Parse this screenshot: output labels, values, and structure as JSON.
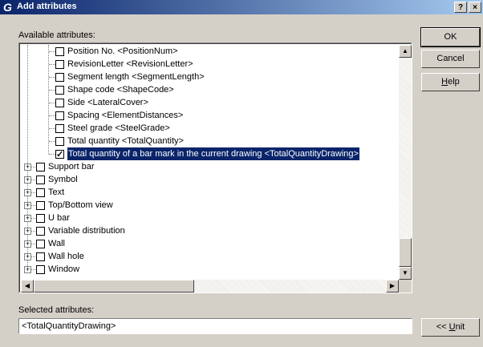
{
  "window": {
    "title": "Add attributes",
    "help_glyph": "?",
    "close_glyph": "×"
  },
  "available_label": "Available attributes:",
  "children": [
    {
      "label": "Position No. <PositionNum>",
      "checked": false
    },
    {
      "label": "RevisionLetter <RevisionLetter>",
      "checked": false
    },
    {
      "label": "Segment length <SegmentLength>",
      "checked": false
    },
    {
      "label": "Shape code <ShapeCode>",
      "checked": false
    },
    {
      "label": "Side <LateralCover>",
      "checked": false
    },
    {
      "label": "Spacing <ElementDistances>",
      "checked": false
    },
    {
      "label": "Steel grade <SteelGrade>",
      "checked": false
    },
    {
      "label": "Total quantity <TotalQuantity>",
      "checked": false
    },
    {
      "label": "Total quantity of a bar mark in the current drawing <TotalQuantityDrawing>",
      "checked": true,
      "selected": true
    }
  ],
  "groups": [
    {
      "label": "Support bar"
    },
    {
      "label": "Symbol"
    },
    {
      "label": "Text"
    },
    {
      "label": "Top/Bottom view"
    },
    {
      "label": "U bar"
    },
    {
      "label": "Variable distribution"
    },
    {
      "label": "Wall"
    },
    {
      "label": "Wall hole"
    },
    {
      "label": "Window"
    }
  ],
  "selected_label": "Selected attributes:",
  "selected_value": "<TotalQuantityDrawing>",
  "buttons": {
    "ok": "OK",
    "cancel": "Cancel",
    "help": "Help",
    "unit": "<< Unit"
  }
}
